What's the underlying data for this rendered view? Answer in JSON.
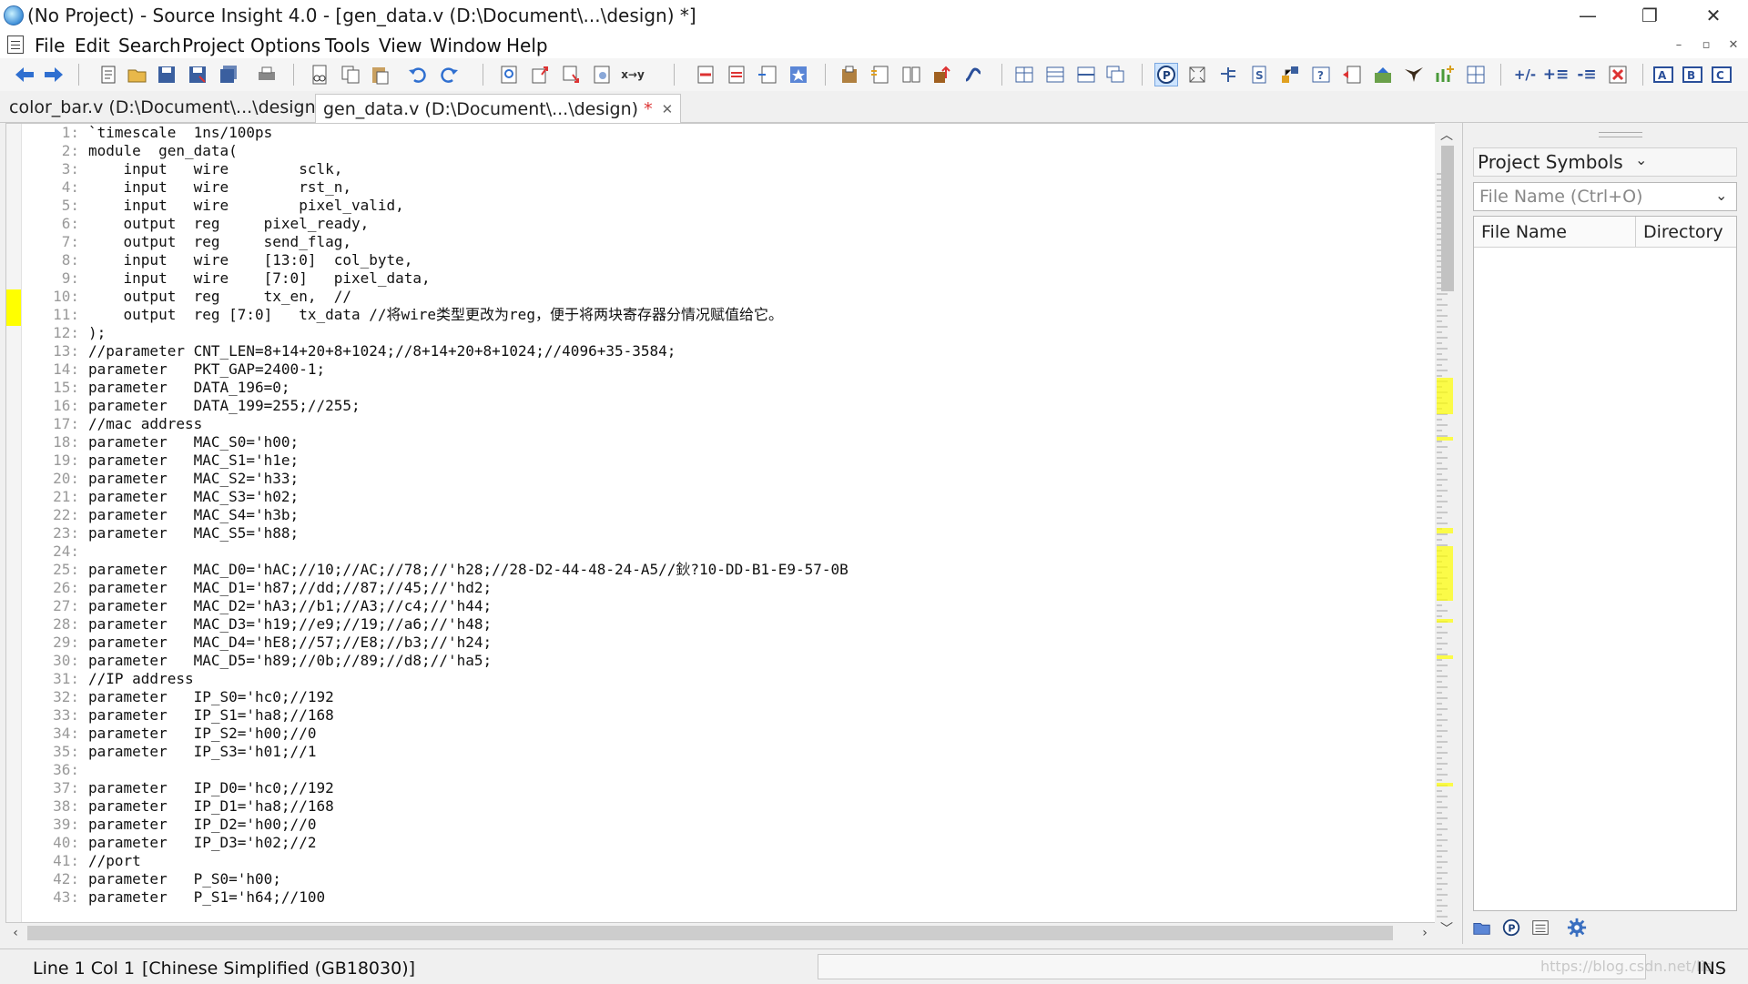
{
  "window": {
    "title": "(No Project) - Source Insight 4.0 - [gen_data.v (D:\\Document\\...\\design) *]",
    "minimize": "—",
    "restore": "❐",
    "close": "✕",
    "icon": "source-insight-globe-icon"
  },
  "menu": [
    "File",
    "Edit",
    "Search",
    "Project",
    "Options",
    "Tools",
    "View",
    "Window",
    "Help"
  ],
  "mdi_controls": {
    "minimize": "–",
    "restore": "▫",
    "close": "✕"
  },
  "tabs": [
    {
      "label": "color_bar.v (D:\\Document\\...\\design)",
      "active": false
    },
    {
      "label": "gen_data.v (D:\\Document\\...\\design)",
      "modified": "*",
      "close": "✕",
      "active": true
    }
  ],
  "editor": {
    "lines": [
      {
        "n": "1:",
        "code": "`timescale  1ns/100ps"
      },
      {
        "n": "2:",
        "code": "module  gen_data("
      },
      {
        "n": "3:",
        "code": "    input   wire        sclk,"
      },
      {
        "n": "4:",
        "code": "    input   wire        rst_n,"
      },
      {
        "n": "5:",
        "code": "    input   wire        pixel_valid,"
      },
      {
        "n": "6:",
        "code": "    output  reg     pixel_ready,"
      },
      {
        "n": "7:",
        "code": "    output  reg     send_flag,"
      },
      {
        "n": "8:",
        "code": "    input   wire    [13:0]  col_byte,"
      },
      {
        "n": "9:",
        "code": "    input   wire    [7:0]   pixel_data,"
      },
      {
        "n": "10:",
        "code": "    output  reg     tx_en,  //"
      },
      {
        "n": "11:",
        "code": "    output  reg [7:0]   tx_data //将wire类型更改为reg，便于将两块寄存器分情况赋值给它。"
      },
      {
        "n": "12:",
        "code": ");"
      },
      {
        "n": "13:",
        "code": "//parameter CNT_LEN=8+14+20+8+1024;//8+14+20+8+1024;//4096+35-3584;"
      },
      {
        "n": "14:",
        "code": "parameter   PKT_GAP=2400-1;"
      },
      {
        "n": "15:",
        "code": "parameter   DATA_196=0;"
      },
      {
        "n": "16:",
        "code": "parameter   DATA_199=255;//255;"
      },
      {
        "n": "17:",
        "code": "//mac address"
      },
      {
        "n": "18:",
        "code": "parameter   MAC_S0='h00;"
      },
      {
        "n": "19:",
        "code": "parameter   MAC_S1='h1e;"
      },
      {
        "n": "20:",
        "code": "parameter   MAC_S2='h33;"
      },
      {
        "n": "21:",
        "code": "parameter   MAC_S3='h02;"
      },
      {
        "n": "22:",
        "code": "parameter   MAC_S4='h3b;"
      },
      {
        "n": "23:",
        "code": "parameter   MAC_S5='h88;"
      },
      {
        "n": "24:",
        "code": ""
      },
      {
        "n": "25:",
        "code": "parameter   MAC_D0='hAC;//10;//AC;//78;//'h28;//28-D2-44-48-24-A5//鈥?10-DD-B1-E9-57-0B"
      },
      {
        "n": "26:",
        "code": "parameter   MAC_D1='h87;//dd;//87;//45;//'hd2;"
      },
      {
        "n": "27:",
        "code": "parameter   MAC_D2='hA3;//b1;//A3;//c4;//'h44;"
      },
      {
        "n": "28:",
        "code": "parameter   MAC_D3='h19;//e9;//19;//a6;//'h48;"
      },
      {
        "n": "29:",
        "code": "parameter   MAC_D4='hE8;//57;//E8;//b3;//'h24;"
      },
      {
        "n": "30:",
        "code": "parameter   MAC_D5='h89;//0b;//89;//d8;//'ha5;"
      },
      {
        "n": "31:",
        "code": "//IP address"
      },
      {
        "n": "32:",
        "code": "parameter   IP_S0='hc0;//192"
      },
      {
        "n": "33:",
        "code": "parameter   IP_S1='ha8;//168"
      },
      {
        "n": "34:",
        "code": "parameter   IP_S2='h00;//0"
      },
      {
        "n": "35:",
        "code": "parameter   IP_S3='h01;//1"
      },
      {
        "n": "36:",
        "code": ""
      },
      {
        "n": "37:",
        "code": "parameter   IP_D0='hc0;//192"
      },
      {
        "n": "38:",
        "code": "parameter   IP_D1='ha8;//168"
      },
      {
        "n": "39:",
        "code": "parameter   IP_D2='h00;//0"
      },
      {
        "n": "40:",
        "code": "parameter   IP_D3='h02;//2"
      },
      {
        "n": "41:",
        "code": "//port"
      },
      {
        "n": "42:",
        "code": "parameter   P_S0='h00;"
      },
      {
        "n": "43:",
        "code": "parameter   P_S1='h64;//100"
      }
    ],
    "highlight_color": "#ffff00"
  },
  "panel": {
    "title": "Project Symbols",
    "dropdown": "⌄",
    "close": "✕",
    "search_placeholder": "File Name (Ctrl+O)",
    "columns": [
      "File Name",
      "Directory"
    ]
  },
  "statusbar": {
    "position": "Line 1  Col 1",
    "encoding": "[Chinese Simplified (GB18030)]",
    "mode": "INS",
    "watermark": "https://blog.csdn.net/lia..."
  },
  "colors": {
    "accent": "#2c4f8a",
    "highlight": "#ffff00"
  }
}
